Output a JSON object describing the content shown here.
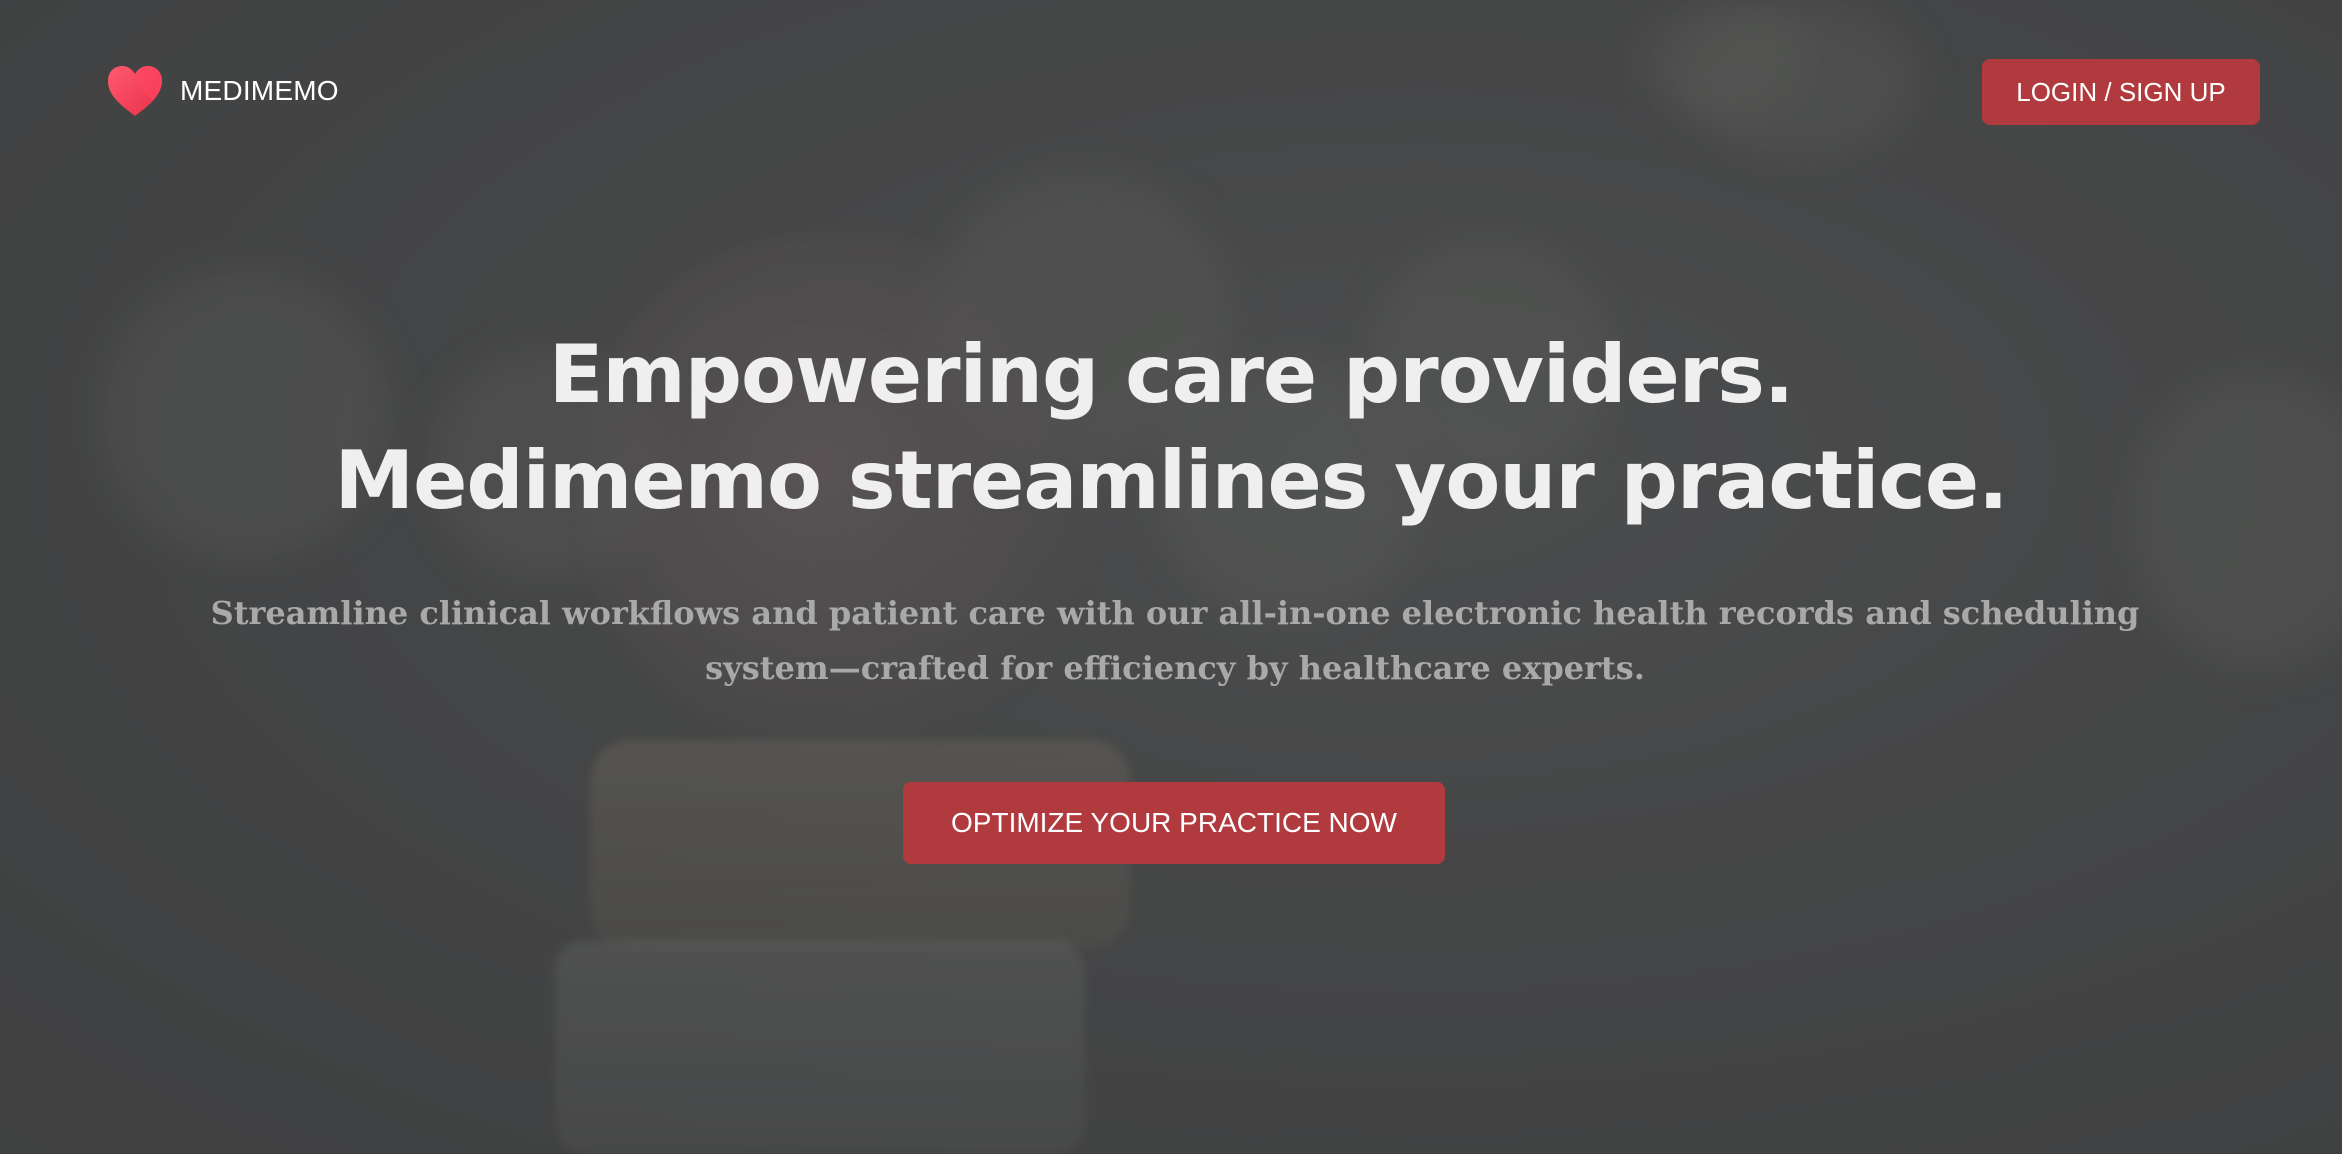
{
  "brand": {
    "name": "MEDIMEMO",
    "icon": "heart-icon",
    "accent_color": "#b13a3f",
    "logo_color": "#f5425b"
  },
  "header": {
    "login_label": "LOGIN / SIGN UP"
  },
  "hero": {
    "title_line1": "Empowering care providers.",
    "title_line2": "Medimemo streamlines your practice.",
    "subtitle": "Streamline clinical workflows and patient care with our all-in-one electronic health records and scheduling system—crafted for efficiency by healthcare experts.",
    "cta_label": "OPTIMIZE YOUR PRACTICE NOW"
  }
}
